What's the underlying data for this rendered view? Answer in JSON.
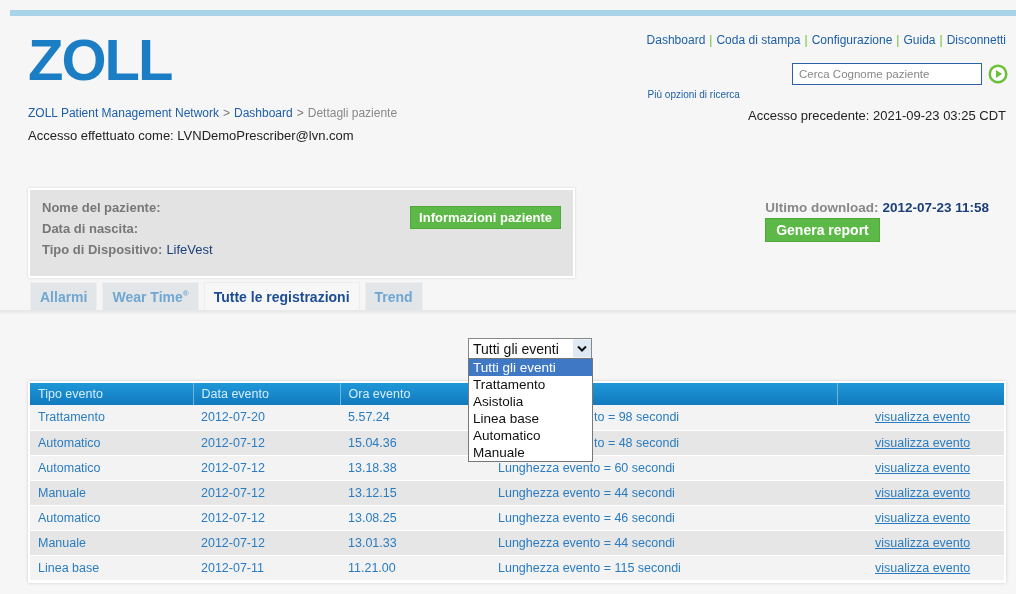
{
  "logo": "ZOLL",
  "top_links": [
    {
      "kind": "link",
      "label": "Dashboard"
    },
    {
      "kind": "separator",
      "label": "|"
    },
    {
      "kind": "link",
      "label": "Coda di stampa"
    },
    {
      "kind": "separator",
      "label": "|"
    },
    {
      "kind": "link",
      "label": "Configurazione"
    },
    {
      "kind": "separator",
      "label": "|"
    },
    {
      "kind": "link",
      "label": "Guida"
    },
    {
      "kind": "separator",
      "label": "|"
    },
    {
      "kind": "link",
      "label": "Disconnetti"
    }
  ],
  "search": {
    "placeholder": "Cerca Cognome paziente",
    "more_link": "Più opzioni di ricerca"
  },
  "breadcrumb": [
    {
      "kind": "link",
      "label": "ZOLL Patient Management Network"
    },
    {
      "kind": "separator",
      "label": ">"
    },
    {
      "kind": "link",
      "label": "Dashboard"
    },
    {
      "kind": "separator",
      "label": ">"
    },
    {
      "kind": "current",
      "label": "Dettagli paziente"
    }
  ],
  "login": "Accesso effettuato come: LVNDemoPrescriber@lvn.com",
  "previous_login": "Accesso precedente: 2021-09-23 03:25 CDT",
  "patient": {
    "fields": [
      {
        "label": "Nome del paziente:"
      },
      {
        "label": "Data di nascita:"
      },
      {
        "label": "Tipo di Dispositivo:",
        "value": "LifeVest"
      }
    ],
    "button": "Informazioni paziente"
  },
  "last_download": {
    "label": "Ultimo download:",
    "value": "2012-07-23 11:58"
  },
  "report_button": "Genera report",
  "tabs": [
    {
      "label": "Allarmi",
      "selected": false
    },
    {
      "label": "Wear Time$^{®}$",
      "selected": false
    },
    {
      "label": "Tutte le registrazioni",
      "selected": true
    },
    {
      "label": "Trend",
      "selected": false
    }
  ],
  "filter": {
    "value": "Tutti gli eventi",
    "expanded": true,
    "options": [
      {
        "label": "Tutti gli eventi",
        "selected": true
      },
      {
        "label": "Trattamento",
        "selected": false
      },
      {
        "label": "Asistolia",
        "selected": false
      },
      {
        "label": "Linea base",
        "selected": false
      },
      {
        "label": "Automatico",
        "selected": false
      },
      {
        "label": "Manuale",
        "selected": false
      }
    ]
  },
  "table": {
    "columns": [
      "Tipo evento",
      "Data evento",
      "Ora evento"
    ],
    "rows": [
      {
        "cells": [
          "Trattamento",
          "2012-07-20",
          "5.57.24",
          "to = 98 secondi"
        ],
        "partly_hidden": true,
        "link": "visualizza evento"
      },
      {
        "cells": [
          "Automatico",
          "2012-07-12",
          "15.04.36",
          "to = 48 secondi"
        ],
        "partly_hidden": true,
        "link": "visualizza evento"
      },
      {
        "cells": [
          "Automatico",
          "2012-07-12",
          "13.18.38",
          "Lunghezza evento = 60 secondi"
        ],
        "partly_hidden": false,
        "link": "visualizza evento"
      },
      {
        "cells": [
          "Manuale",
          "2012-07-12",
          "13.12.15",
          "Lunghezza evento = 44 secondi"
        ],
        "partly_hidden": false,
        "link": "visualizza evento"
      },
      {
        "cells": [
          "Automatico",
          "2012-07-12",
          "13.08.25",
          "Lunghezza evento = 46 secondi"
        ],
        "partly_hidden": false,
        "link": "visualizza evento"
      },
      {
        "cells": [
          "Manuale",
          "2012-07-12",
          "13.01.33",
          "Lunghezza evento = 44 secondi"
        ],
        "partly_hidden": false,
        "link": "visualizza evento"
      },
      {
        "cells": [
          "Linea base",
          "2012-07-11",
          "11.21.00",
          "Lunghezza evento = 115 secondi"
        ],
        "partly_hidden": false,
        "link": "visualizza evento"
      }
    ]
  }
}
